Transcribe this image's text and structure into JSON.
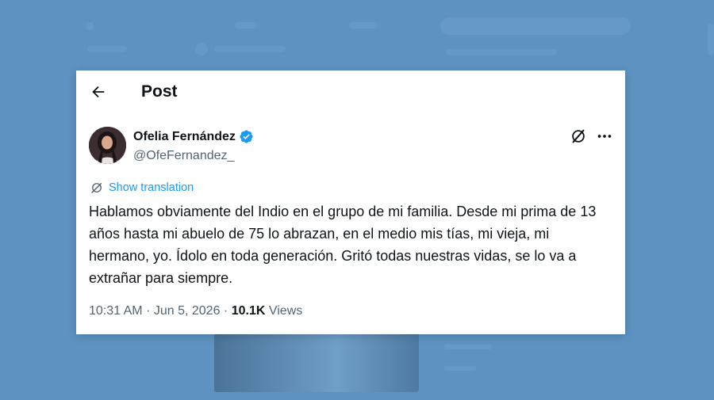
{
  "header": {
    "title": "Post"
  },
  "author": {
    "name": "Ofelia Fernández",
    "handle": "@OfeFernandez_",
    "verified_color": "#1d9bf0"
  },
  "translate_label": "Show translation",
  "tweet": {
    "text": "Hablamos obviamente del Indio en el grupo de mi familia. Desde mi prima de 13 años hasta mi abuelo de 75 lo abrazan, en el medio mis tías, mi vieja, mi hermano, yo. Ídolo en toda generación. Gritó todas nuestras vidas, se lo va a extrañar para siempre.",
    "time": "10:31 AM",
    "date": "Jun 5, 2026",
    "views_count": "10.1K",
    "views_label": "Views"
  },
  "icons": [
    "back-arrow-icon",
    "verified-badge-icon",
    "grok-icon",
    "more-icon",
    "translate-icon"
  ],
  "colors": {
    "background": "#5b8fbe",
    "accent": "#1d9bf0",
    "text": "#0f1419",
    "secondary": "#536471"
  }
}
